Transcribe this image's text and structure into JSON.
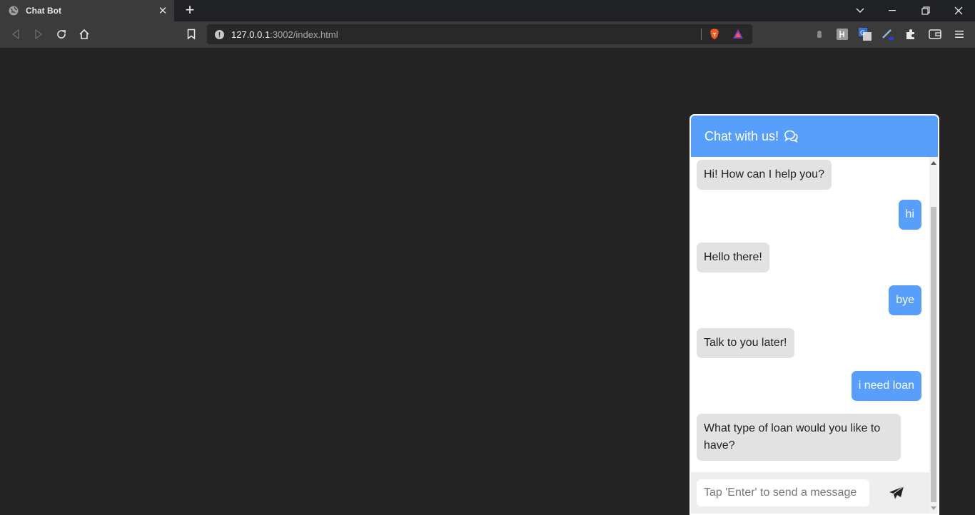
{
  "browser": {
    "tab_title": "Chat Bot",
    "url_host": "127.0.0.1",
    "url_path": ":3002/index.html"
  },
  "chat": {
    "header_title": "Chat with us!",
    "messages": [
      {
        "sender": "bot",
        "text": "Hi! How can I help you?"
      },
      {
        "sender": "user",
        "text": "hi"
      },
      {
        "sender": "bot",
        "text": "Hello there!"
      },
      {
        "sender": "user",
        "text": "bye"
      },
      {
        "sender": "bot",
        "text": "Talk to you later!"
      },
      {
        "sender": "user",
        "text": "i need loan"
      },
      {
        "sender": "bot",
        "text": "What type of loan would you like to have?"
      }
    ],
    "input_placeholder": "Tap 'Enter' to send a message",
    "input_value": ""
  },
  "colors": {
    "accent": "#579ffb",
    "bot_bubble": "#e2e2e2",
    "page_bg": "#232323"
  }
}
